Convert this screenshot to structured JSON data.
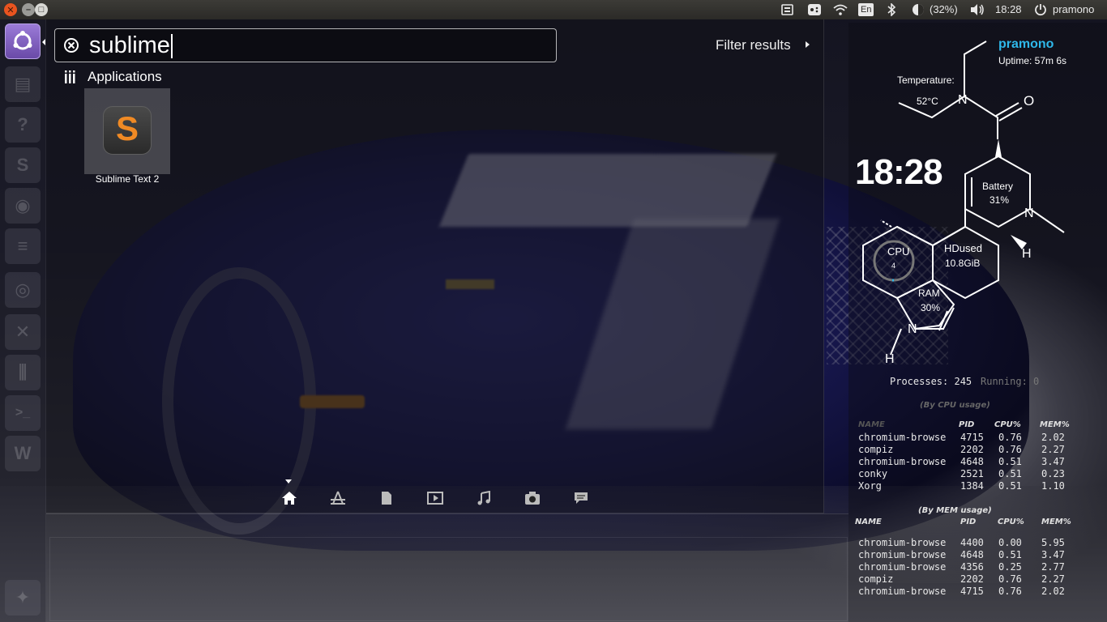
{
  "panel": {
    "close_glyph": "✕",
    "min_glyph": "–",
    "max_glyph": "□",
    "keyboard_layout": "En",
    "battery": "(32%)",
    "clock": "18:28",
    "user": "pramono"
  },
  "launcher": {
    "items": [
      {
        "icon": "dash-home-icon"
      },
      {
        "icon": "files-icon"
      },
      {
        "icon": "help-icon"
      },
      {
        "icon": "sublime-launcher-icon",
        "glyph": "S"
      },
      {
        "icon": "disc-icon"
      },
      {
        "icon": "dock-icon"
      },
      {
        "icon": "camera-icon"
      },
      {
        "icon": "tools-icon"
      },
      {
        "icon": "mixer-icon"
      },
      {
        "icon": "terminal-icon",
        "glyph": ">_"
      },
      {
        "icon": "writer-icon",
        "glyph": "W"
      },
      {
        "icon": "settings-icon"
      }
    ]
  },
  "dash": {
    "search_value": "sublime",
    "filter_label": "Filter results",
    "category": "Applications",
    "results": [
      {
        "label": "Sublime Text 2",
        "icon": "sublime-text-icon",
        "glyph": "S"
      }
    ],
    "lenses": [
      "home-lens-icon",
      "applications-lens-icon",
      "files-lens-icon",
      "video-lens-icon",
      "music-lens-icon",
      "photo-lens-icon",
      "social-lens-icon"
    ]
  },
  "conky": {
    "username": "pramono",
    "uptime": "Uptime: 57m 6s",
    "temperature_label": "Temperature:",
    "temperature_value": "52°C",
    "clock": "18:28",
    "battery_label": "Battery",
    "battery_value": "31%",
    "cpu_label": "CPU",
    "cpu_value": "4",
    "hdd_label": "HDused",
    "hdd_value": "10.8GiB",
    "ram_label": "RAM",
    "ram_value": "30%",
    "n_atom": "N",
    "o_atom": "O",
    "h_atom": "H",
    "processes_label": "Processes: 245",
    "running_label": "Running: 0",
    "cpu_table": {
      "title": "(By CPU usage)",
      "headers": [
        "NAME",
        "PID",
        "CPU%",
        "MEM%"
      ],
      "rows": [
        [
          "chromium-browse",
          "4715",
          "0.76",
          "2.02"
        ],
        [
          "compiz",
          "2202",
          "0.76",
          "2.27"
        ],
        [
          "chromium-browse",
          "4648",
          "0.51",
          "3.47"
        ],
        [
          "conky",
          "2521",
          "0.51",
          "0.23"
        ],
        [
          "Xorg",
          "1384",
          "0.51",
          "1.10"
        ]
      ]
    },
    "mem_table": {
      "title": "(By MEM usage)",
      "headers": [
        "NAME",
        "PID",
        "CPU%",
        "MEM%"
      ],
      "rows": [
        [
          "chromium-browse",
          "4400",
          "0.00",
          "5.95"
        ],
        [
          "chromium-browse",
          "4648",
          "0.51",
          "3.47"
        ],
        [
          "chromium-browse",
          "4356",
          "0.25",
          "2.77"
        ],
        [
          "compiz",
          "2202",
          "0.76",
          "2.27"
        ],
        [
          "chromium-browse",
          "4715",
          "0.76",
          "2.02"
        ]
      ]
    },
    "accent": "#2fb8ea"
  }
}
